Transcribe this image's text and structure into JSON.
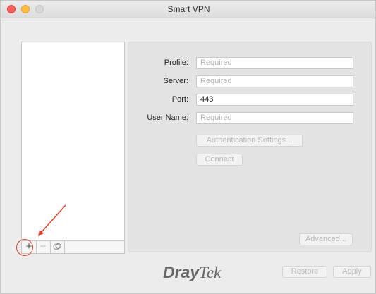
{
  "window": {
    "title": "Smart VPN"
  },
  "profile_list": {
    "add_symbol": "+",
    "remove_symbol": "−",
    "duplicate_symbol": "⧉"
  },
  "form": {
    "profile": {
      "label": "Profile:",
      "placeholder": "Required",
      "value": ""
    },
    "server": {
      "label": "Server:",
      "placeholder": "Required",
      "value": ""
    },
    "port": {
      "label": "Port:",
      "value": "443"
    },
    "username": {
      "label": "User Name:",
      "placeholder": "Required",
      "value": ""
    }
  },
  "buttons": {
    "auth_settings": "Authentication Settings...",
    "connect": "Connect",
    "advanced": "Advanced...",
    "restore": "Restore",
    "apply": "Apply"
  },
  "branding": {
    "logo_part1": "Dray",
    "logo_part2": "Tek"
  },
  "colors": {
    "annotation": "#e2402a",
    "panel": "#e3e3e3",
    "window": "#ececec"
  }
}
